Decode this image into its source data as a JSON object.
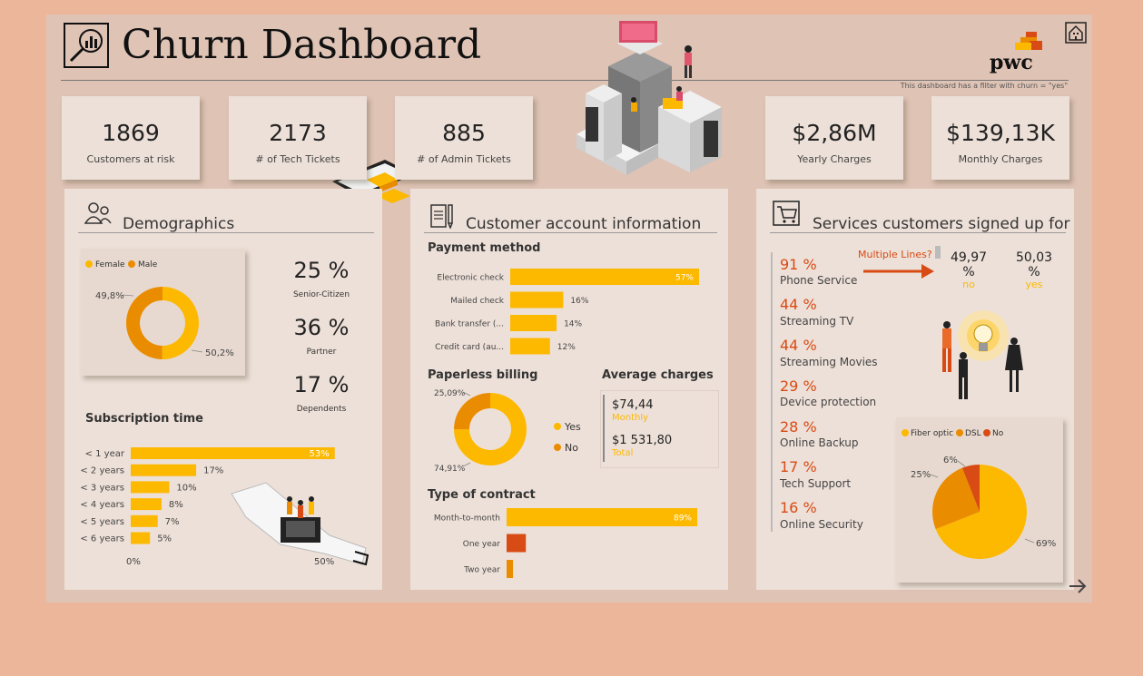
{
  "header": {
    "title": "Churn Dashboard",
    "filter_note": "This dashboard has a filter with churn = \"yes\"",
    "logo_text": "pwc"
  },
  "kpis": [
    {
      "value": "1869",
      "label": "Customers at risk"
    },
    {
      "value": "2173",
      "label": "# of Tech Tickets"
    },
    {
      "value": "885",
      "label": "# of Admin Tickets"
    },
    {
      "value": "$2,86M",
      "label": "Yearly Charges"
    },
    {
      "value": "$139,13K",
      "label": "Monthly Charges"
    }
  ],
  "demographics": {
    "title": "Demographics",
    "stats": [
      {
        "value": "25 %",
        "label": "Senior-Citizen"
      },
      {
        "value": "36 %",
        "label": "Partner"
      },
      {
        "value": "17 %",
        "label": "Dependents"
      }
    ],
    "subscription_title": "Subscription time"
  },
  "account": {
    "title": "Customer account information",
    "payment_title": "Payment method",
    "paperless_title": "Paperless billing",
    "avg_title": "Average charges",
    "avg_monthly_value": "$74,44",
    "avg_monthly_label": "Monthly",
    "avg_total_value": "$1 531,80",
    "avg_total_label": "Total",
    "contract_title": "Type of contract"
  },
  "services": {
    "title": "Services customers signed up for",
    "items": [
      {
        "value": "91 %",
        "label": "Phone Service"
      },
      {
        "value": "44 %",
        "label": "Streaming TV"
      },
      {
        "value": "44 %",
        "label": "Streaming Movies"
      },
      {
        "value": "29 %",
        "label": "Device protection"
      },
      {
        "value": "28 %",
        "label": "Online Backup"
      },
      {
        "value": "17 %",
        "label": "Tech Support"
      },
      {
        "value": "16 %",
        "label": "Online Security"
      }
    ],
    "multiple_lines_label": "Multiple Lines?",
    "multiple_lines": [
      {
        "value": "49,97",
        "unit": "%",
        "label": "no"
      },
      {
        "value": "50,03",
        "unit": "%",
        "label": "yes"
      }
    ]
  },
  "colors": {
    "yellow": "#fdb800",
    "orange": "#ea8c00",
    "red_orange": "#d84b14",
    "panel": "#ede0d8",
    "background": "#ecb69b"
  },
  "chart_data": [
    {
      "id": "gender",
      "type": "pie",
      "donut": true,
      "legend": [
        "Female",
        "Male"
      ],
      "slices": [
        {
          "name": "Female",
          "value": 50.2,
          "label": "50,2%",
          "color": "#fdb800"
        },
        {
          "name": "Male",
          "value": 49.8,
          "label": "49,8%",
          "color": "#ea8c00"
        }
      ]
    },
    {
      "id": "subscription",
      "type": "bar",
      "orientation": "horizontal",
      "categories": [
        "< 1 year",
        "< 2 years",
        "< 3 years",
        "< 4 years",
        "< 5 years",
        "< 6 years"
      ],
      "values": [
        53,
        17,
        10,
        8,
        7,
        5
      ],
      "labels": [
        "53%",
        "17%",
        "10%",
        "8%",
        "7%",
        "5%"
      ],
      "xlim": [
        0,
        50
      ],
      "xticks": [
        "0%",
        "50%"
      ]
    },
    {
      "id": "payment",
      "type": "bar",
      "orientation": "horizontal",
      "categories": [
        "Electronic check",
        "Mailed check",
        "Bank transfer (...",
        "Credit card (au..."
      ],
      "values": [
        57,
        16,
        14,
        12
      ],
      "labels": [
        "57%",
        "16%",
        "14%",
        "12%"
      ],
      "xlim": [
        0,
        57
      ]
    },
    {
      "id": "paperless",
      "type": "pie",
      "donut": true,
      "legend": [
        "Yes",
        "No"
      ],
      "slices": [
        {
          "name": "Yes",
          "value": 74.91,
          "label": "74,91%",
          "color": "#fdb800"
        },
        {
          "name": "No",
          "value": 25.09,
          "label": "25,09%",
          "color": "#ea8c00"
        }
      ]
    },
    {
      "id": "contract",
      "type": "bar",
      "orientation": "horizontal",
      "categories": [
        "Month-to-month",
        "One year",
        "Two year"
      ],
      "values": [
        89,
        9,
        3
      ],
      "labels": [
        "89%",
        "",
        ""
      ],
      "colors": [
        "#fdb800",
        "#d84b14",
        "#ea8c00"
      ],
      "xlim": [
        0,
        89
      ]
    },
    {
      "id": "internet",
      "type": "pie",
      "legend": [
        "Fiber optic",
        "DSL",
        "No"
      ],
      "slices": [
        {
          "name": "Fiber optic",
          "value": 69,
          "label": "69%",
          "color": "#fdb800"
        },
        {
          "name": "DSL",
          "value": 25,
          "label": "25%",
          "color": "#ea8c00"
        },
        {
          "name": "No",
          "value": 6,
          "label": "6%",
          "color": "#d84b14"
        }
      ]
    }
  ]
}
